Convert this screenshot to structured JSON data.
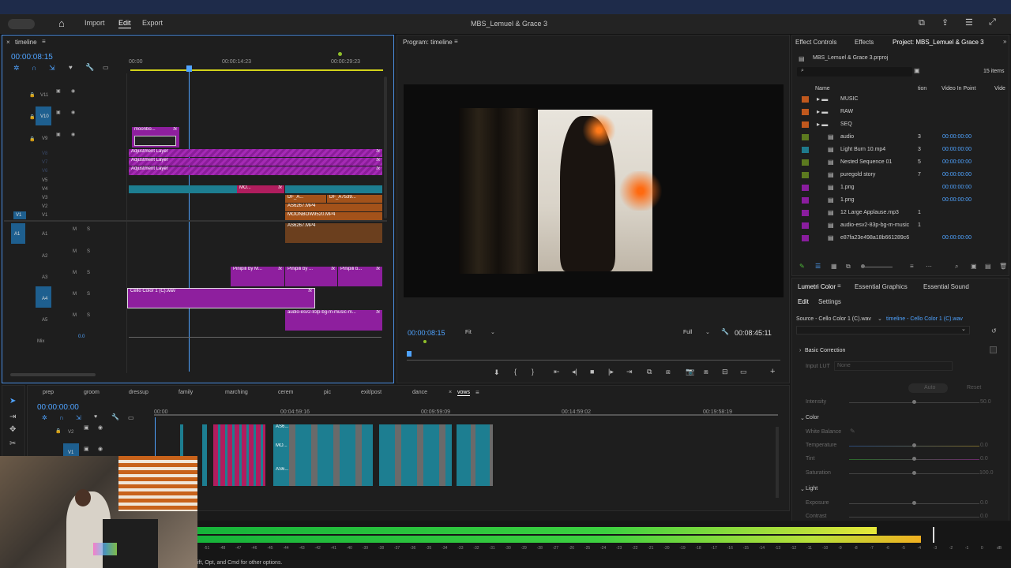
{
  "mac": {
    "apple_glyph": ""
  },
  "header": {
    "title": "MBS_Lemuel & Grace 3",
    "nav": [
      "Import",
      "Edit",
      "Export"
    ]
  },
  "timeline_panel": {
    "tab": "timeline",
    "timecode": "00:00:08:15",
    "ruler": [
      "00:00",
      "00:00:14:23",
      "00:00:29:23"
    ],
    "video_tracks": [
      "V11",
      "V10",
      "V9",
      "V8",
      "V7",
      "V6",
      "V5",
      "V4",
      "V3",
      "V2",
      "V1"
    ],
    "audio_tracks": [
      "A1",
      "A2",
      "A3",
      "A4",
      "A5"
    ],
    "mix_label": "Mix",
    "mix_value": "0.0",
    "mute": "M",
    "solo": "S",
    "source_v1": "V1",
    "source_a1": "A1",
    "clips": {
      "moonbo": "moonbo...",
      "adj1": "Adjustment Layer",
      "adj2": "Adjustment Layer",
      "adj3": "Adjustment Layer",
      "mo": "MO...",
      "df_a": "DF_A...",
      "df_a7539": "DF_A7539...",
      "as6267_v2": "AS6267.MP4",
      "moonbow": "MOONBOW9520.MP4",
      "as6267_a1": "AS6267.MP4",
      "pinipili1": "Pinipili by M...",
      "pinipili2": "Pinipili by ...",
      "pinipili3": "Pinipili b...",
      "cello": "Cello Color 1 (C).wav",
      "audio_esv2": "audio-esv2-83p-bg-m-music-m...",
      "fx": "fx"
    }
  },
  "program_monitor": {
    "tab": "Program: timeline",
    "timecode": "00:00:08:15",
    "fit": "Fit",
    "resolution": "Full",
    "duration": "00:08:45:11"
  },
  "project_panel": {
    "tabs": [
      "Effect Controls",
      "Effects",
      "Project: MBS_Lemuel & Grace 3"
    ],
    "file": "MBS_Lemuel & Grace 3.prproj",
    "items_count": "15 items",
    "columns": [
      "Name",
      "tion",
      "Video In Point",
      "Vide"
    ],
    "rows": [
      {
        "name": "MUSIC",
        "color": "#c0581d",
        "tn": "",
        "vin": ""
      },
      {
        "name": "RAW",
        "color": "#c0581d",
        "tn": "",
        "vin": ""
      },
      {
        "name": "SEQ",
        "color": "#c0581d",
        "tn": "",
        "vin": ""
      },
      {
        "name": "audio",
        "color": "#5c7a1f",
        "tn": "3",
        "vin": "00:00:00:00"
      },
      {
        "name": "Light Burn 10.mp4",
        "color": "#1f7a8c",
        "tn": "3",
        "vin": "00:00:00:00"
      },
      {
        "name": "Nested Sequence 01",
        "color": "#5c7a1f",
        "tn": "5",
        "vin": "00:00:00:00"
      },
      {
        "name": "puregold story",
        "color": "#5c7a1f",
        "tn": "7",
        "vin": "00:00:00:00"
      },
      {
        "name": "1.png",
        "color": "#8a1d9e",
        "tn": "",
        "vin": "00:00:00:00"
      },
      {
        "name": "1.png",
        "color": "#8a1d9e",
        "tn": "",
        "vin": "00:00:00:00"
      },
      {
        "name": "12 Large Applause.mp3",
        "color": "#8a1d9e",
        "tn": "1",
        "vin": ""
      },
      {
        "name": "audio-esv2-83p-bg-m-music",
        "color": "#8a1d9e",
        "tn": "1",
        "vin": ""
      },
      {
        "name": "e87fa23e498a18b661289c6",
        "color": "#8a1d9e",
        "tn": "",
        "vin": "00:00:00:00"
      }
    ]
  },
  "lumetri": {
    "tabs": [
      "Lumetri Color",
      "Essential Graphics",
      "Essential Sound"
    ],
    "subtabs": [
      "Edit",
      "Settings"
    ],
    "source": "Source - Cello Color 1 (C).wav",
    "target": "timeline - Cello Color 1 (C).wav",
    "basic_correction": "Basic Correction",
    "input_lut_label": "Input LUT",
    "input_lut_value": "None",
    "auto": "Auto",
    "reset": "Reset",
    "intensity": "Intensity",
    "intensity_val": "50.0",
    "color_section": "Color",
    "white_balance": "White Balance",
    "temperature": "Temperature",
    "temperature_val": "0.0",
    "tint": "Tint",
    "tint_val": "0.0",
    "saturation": "Saturation",
    "saturation_val": "100.0",
    "light_section": "Light",
    "exposure": "Exposure",
    "exposure_val": "0.0",
    "contrast": "Contrast",
    "contrast_val": "0.0"
  },
  "sequence_tabs": [
    "prep",
    "groom",
    "dressup",
    "family",
    "marching",
    "cerem",
    "pic",
    "exit/post",
    "dance",
    "vows"
  ],
  "lower_timeline": {
    "timecode": "00:00:00:00",
    "ruler": [
      "00:00",
      "00:04:59:16",
      "00:09:59:09",
      "00:14:59:02",
      "00:19:58:19"
    ],
    "tracks": [
      "V2",
      "V1"
    ],
    "clip_as6": "AS6...",
    "clip_mo": "MO...",
    "clip_as6_b": "AS6..."
  },
  "meter_ticks": [
    "-51",
    "-48",
    "-47",
    "-46",
    "-45",
    "-44",
    "-43",
    "-42",
    "-41",
    "-40",
    "-39",
    "-38",
    "-37",
    "-36",
    "-35",
    "-34",
    "-33",
    "-32",
    "-31",
    "-30",
    "-29",
    "-28",
    "-27",
    "-26",
    "-25",
    "-24",
    "-23",
    "-22",
    "-21",
    "-20",
    "-19",
    "-18",
    "-17",
    "-16",
    "-15",
    "-14",
    "-13",
    "-12",
    "-11",
    "-10",
    "-9",
    "-8",
    "-7",
    "-6",
    "-5",
    "-4",
    "-3",
    "-2",
    "-1",
    "0",
    "dB"
  ],
  "status_text": "ift, Opt, and Cmd for other options."
}
